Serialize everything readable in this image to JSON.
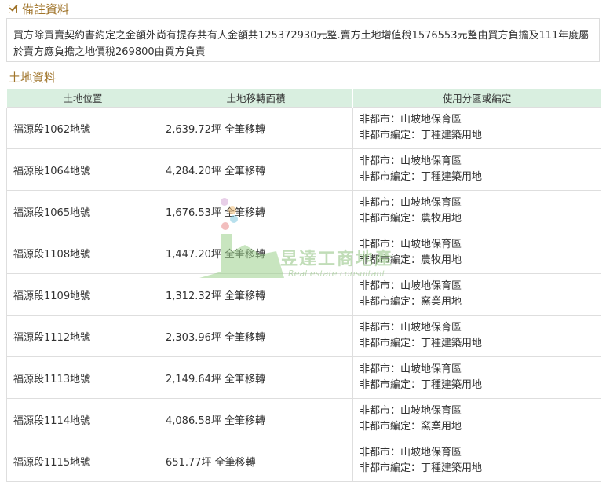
{
  "remark": {
    "title": "備註資料",
    "text": "買方除買賣契約書約定之金額外尚有提存共有人金額共125372930元整.賣方土地增值稅1576553元整由買方負擔及111年度屬於賣方應負擔之地價稅269800由買方負責"
  },
  "land": {
    "title": "土地資料",
    "headers": [
      "土地位置",
      "土地移轉面積",
      "使用分區或編定"
    ],
    "rows": [
      {
        "location": "福源段1062地號",
        "area": "2,639.72坪 全筆移轉",
        "zone": "非都市：山坡地保育區",
        "use": "非都市編定：丁種建築用地"
      },
      {
        "location": "福源段1064地號",
        "area": "4,284.20坪 全筆移轉",
        "zone": "非都市：山坡地保育區",
        "use": "非都市編定：丁種建築用地"
      },
      {
        "location": "福源段1065地號",
        "area": "1,676.53坪 全筆移轉",
        "zone": "非都市：山坡地保育區",
        "use": "非都市編定：農牧用地"
      },
      {
        "location": "福源段1108地號",
        "area": "1,447.20坪 全筆移轉",
        "zone": "非都市：山坡地保育區",
        "use": "非都市編定：農牧用地"
      },
      {
        "location": "福源段1109地號",
        "area": "1,312.32坪 全筆移轉",
        "zone": "非都市：山坡地保育區",
        "use": "非都市編定：窯業用地"
      },
      {
        "location": "福源段1112地號",
        "area": "2,303.96坪 全筆移轉",
        "zone": "非都市：山坡地保育區",
        "use": "非都市編定：丁種建築用地"
      },
      {
        "location": "福源段1113地號",
        "area": "2,149.64坪 全筆移轉",
        "zone": "非都市：山坡地保育區",
        "use": "非都市編定：丁種建築用地"
      },
      {
        "location": "福源段1114地號",
        "area": "4,086.58坪 全筆移轉",
        "zone": "非都市：山坡地保育區",
        "use": "非都市編定：窯業用地"
      },
      {
        "location": "福源段1115地號",
        "area": "651.77坪 全筆移轉",
        "zone": "非都市：山坡地保育區",
        "use": "非都市編定：丁種建築用地"
      }
    ]
  },
  "watermark": {
    "name": "昱達工商地產",
    "subtitle": "Real estate consultant"
  },
  "colors": {
    "accent": "#a0742a",
    "header_bg": "#d9efe0"
  }
}
